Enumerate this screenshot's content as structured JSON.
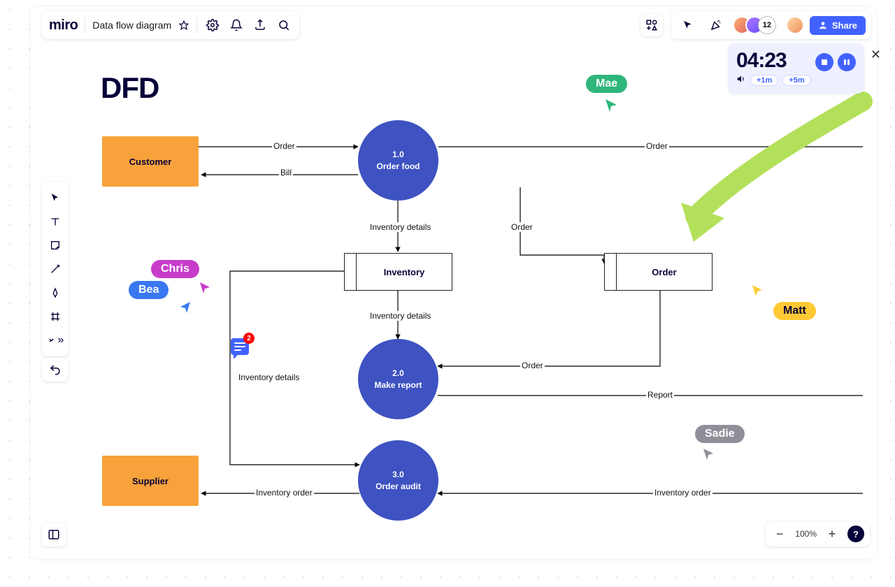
{
  "app": {
    "logo": "miro",
    "board_name": "Data flow diagram"
  },
  "topbar_icons": {
    "star": "star-icon",
    "settings": "settings-icon",
    "notifications": "bell-icon",
    "export": "export-icon",
    "search": "search-icon"
  },
  "top_right": {
    "apps": "apps-icon",
    "present": "cursor-arrow-icon",
    "reactions": "confetti-icon",
    "participant_count": "12",
    "share_label": "Share"
  },
  "timer": {
    "time": "04:23",
    "add_1m": "+1m",
    "add_5m": "+5m"
  },
  "diagram": {
    "title": "DFD",
    "entities": {
      "customer": "Customer",
      "supplier": "Supplier"
    },
    "processes": {
      "p1_num": "1.0",
      "p1_name": "Order food",
      "p2_num": "2.0",
      "p2_name": "Make report",
      "p3_num": "3.0",
      "p3_name": "Order audit"
    },
    "datastores": {
      "inventory": "Inventory",
      "order": "Order"
    },
    "flows": {
      "order1": "Order",
      "bill": "Bill",
      "order2": "Order",
      "inv_details1": "Inventory details",
      "inv_details2": "Inventory details",
      "order3": "Order",
      "inv_details3": "Inventory details",
      "order4": "Order",
      "report": "Report",
      "inv_order1": "Inventory order",
      "inv_order2": "Inventory order"
    }
  },
  "users": {
    "mae": "Mae",
    "chris": "Chris",
    "bea": "Bea",
    "matt": "Matt",
    "sadie": "Sadie"
  },
  "comment": {
    "count": "2"
  },
  "zoom": {
    "percent": "100%"
  },
  "colors": {
    "brand_blue": "#4262FF",
    "process_blue": "#3E52C1",
    "entity_orange": "#F7A23B",
    "mae_green": "#2FB67C",
    "chris_magenta": "#C83CCB",
    "bea_blue": "#3A78F2",
    "matt_yellow": "#FFC933",
    "sadie_gray": "#8F8F99",
    "arrow_green": "#B3E05A"
  }
}
